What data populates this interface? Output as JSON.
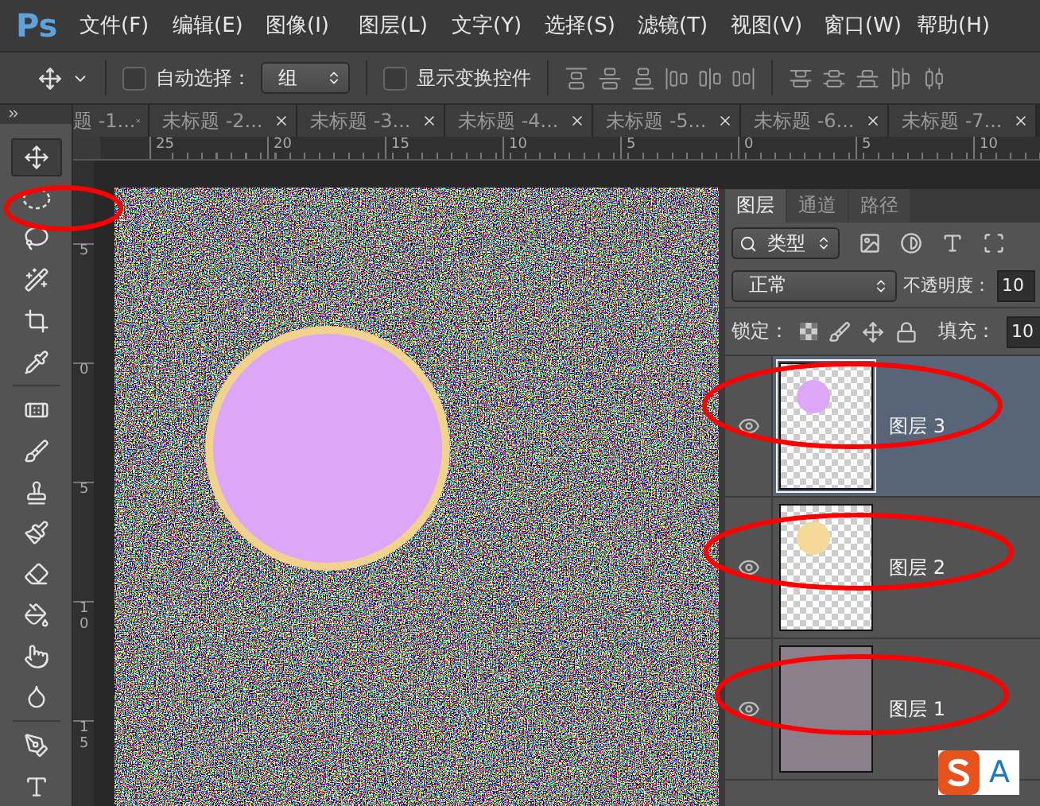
{
  "menu": {
    "logo": "Ps",
    "items": [
      "文件(F)",
      "编辑(E)",
      "图像(I)",
      "图层(L)",
      "文字(Y)",
      "选择(S)",
      "滤镜(T)",
      "视图(V)",
      "窗口(W)",
      "帮助(H)"
    ]
  },
  "options": {
    "auto_select": {
      "label": "自动选择：",
      "checked": false
    },
    "group_select": {
      "value": "组"
    },
    "show_transform": {
      "label": "显示变换控件",
      "checked": false
    }
  },
  "document_tabs": [
    {
      "label": "题 -1..."
    },
    {
      "label": "未标题 -2..."
    },
    {
      "label": "未标题 -3..."
    },
    {
      "label": "未标题 -4..."
    },
    {
      "label": "未标题 -5..."
    },
    {
      "label": "未标题 -6..."
    },
    {
      "label": "未标题 -7..."
    }
  ],
  "rulers": {
    "horizontal": [
      "25",
      "20",
      "15",
      "10",
      "5",
      "0",
      "5",
      "10"
    ],
    "vertical": [
      "5",
      "0",
      "5",
      "10",
      "15"
    ]
  },
  "tools": [
    {
      "kind": "move",
      "selected": true
    },
    {
      "kind": "ellipse",
      "selected": false
    },
    {
      "kind": "lasso",
      "selected": false
    },
    {
      "kind": "wand",
      "selected": false
    },
    {
      "kind": "crop",
      "selected": false
    },
    {
      "kind": "eyedropper",
      "selected": false
    },
    {
      "kind": "heal",
      "selected": false
    },
    {
      "kind": "brush",
      "selected": false
    },
    {
      "kind": "stamp",
      "selected": false
    },
    {
      "kind": "history",
      "selected": false
    },
    {
      "kind": "eraser",
      "selected": false
    },
    {
      "kind": "bucket",
      "selected": false
    },
    {
      "kind": "smudge",
      "selected": false
    },
    {
      "kind": "sponge",
      "selected": false
    },
    {
      "kind": "pen",
      "selected": false
    },
    {
      "kind": "type",
      "selected": false
    }
  ],
  "layers_panel": {
    "tabs": [
      {
        "label": "图层",
        "selected": true
      },
      {
        "label": "通道",
        "selected": false
      },
      {
        "label": "路径",
        "selected": false
      }
    ],
    "filter": {
      "value": "类型"
    },
    "blend_mode": {
      "value": "正常"
    },
    "opacity": {
      "label": "不透明度：",
      "value": "10"
    },
    "lock_label": "锁定：",
    "fill": {
      "label": "填充：",
      "value": "10"
    },
    "layers": [
      {
        "name": "图层 3",
        "visible": true,
        "selected": true,
        "thumbnail": {
          "kind": "dot",
          "color": "#dda6f7"
        }
      },
      {
        "name": "图层 2",
        "visible": true,
        "selected": false,
        "thumbnail": {
          "kind": "dot",
          "color": "#f5d998"
        }
      },
      {
        "name": "图层 1",
        "visible": true,
        "selected": false,
        "thumbnail": {
          "kind": "noise"
        }
      }
    ]
  },
  "ime": {
    "label": "A"
  }
}
